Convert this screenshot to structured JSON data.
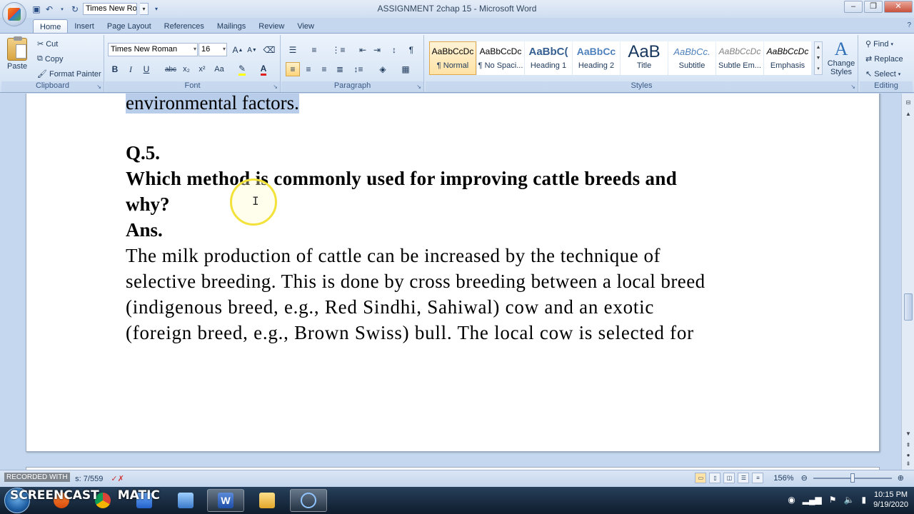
{
  "titlebar": {
    "title": "ASSIGNMENT 2chap 15 - Microsoft Word",
    "qat_font": "Times New Roman",
    "minimize": "–",
    "restore": "❐",
    "close": "✕"
  },
  "tabs": [
    "Home",
    "Insert",
    "Page Layout",
    "References",
    "Mailings",
    "Review",
    "View"
  ],
  "ribbon": {
    "clipboard": {
      "label": "Clipboard",
      "paste": "Paste",
      "cut": "Cut",
      "copy": "Copy",
      "format_painter": "Format Painter"
    },
    "font": {
      "label": "Font",
      "font_name": "Times New Roman",
      "font_size": "16"
    },
    "paragraph": {
      "label": "Paragraph"
    },
    "styles": {
      "label": "Styles",
      "items": [
        {
          "preview": "AaBbCcDc",
          "name": "¶ Normal"
        },
        {
          "preview": "AaBbCcDc",
          "name": "¶ No Spaci..."
        },
        {
          "preview": "AaBbC(",
          "name": "Heading 1"
        },
        {
          "preview": "AaBbCc",
          "name": "Heading 2"
        },
        {
          "preview": "AaB",
          "name": "Title"
        },
        {
          "preview": "AaBbCc.",
          "name": "Subtitle"
        },
        {
          "preview": "AaBbCcDc",
          "name": "Subtle Em..."
        },
        {
          "preview": "AaBbCcDc",
          "name": "Emphasis"
        }
      ],
      "change_styles": "Change Styles"
    },
    "editing": {
      "label": "Editing",
      "find": "Find",
      "replace": "Replace",
      "select": "Select"
    }
  },
  "document": {
    "line1": "environmental factors.",
    "q_label": "Q.5.",
    "question_line1": "Which method is commonly used for improving cattle breeds and",
    "question_line2": "why?",
    "ans_label": "Ans.",
    "answer_lines": [
      "The milk production of cattle can be increased by the technique of",
      "selective breeding. This is done by cross breeding between a local breed",
      "(indigenous breed, e.g., Red Sindhi, Sahiwal) cow and an exotic",
      "(foreign breed, e.g., Brown Swiss) bull. The local cow is selected for"
    ]
  },
  "statusbar": {
    "words": "7/559",
    "words_prefix": "s:",
    "zoom": "156%"
  },
  "overlay": {
    "recorded_with": "RECORDED WITH",
    "screencast": "SCREENCAST",
    "matic": "MATIC"
  },
  "taskbar": {
    "time": "10:15 PM",
    "date": "9/19/2020"
  }
}
